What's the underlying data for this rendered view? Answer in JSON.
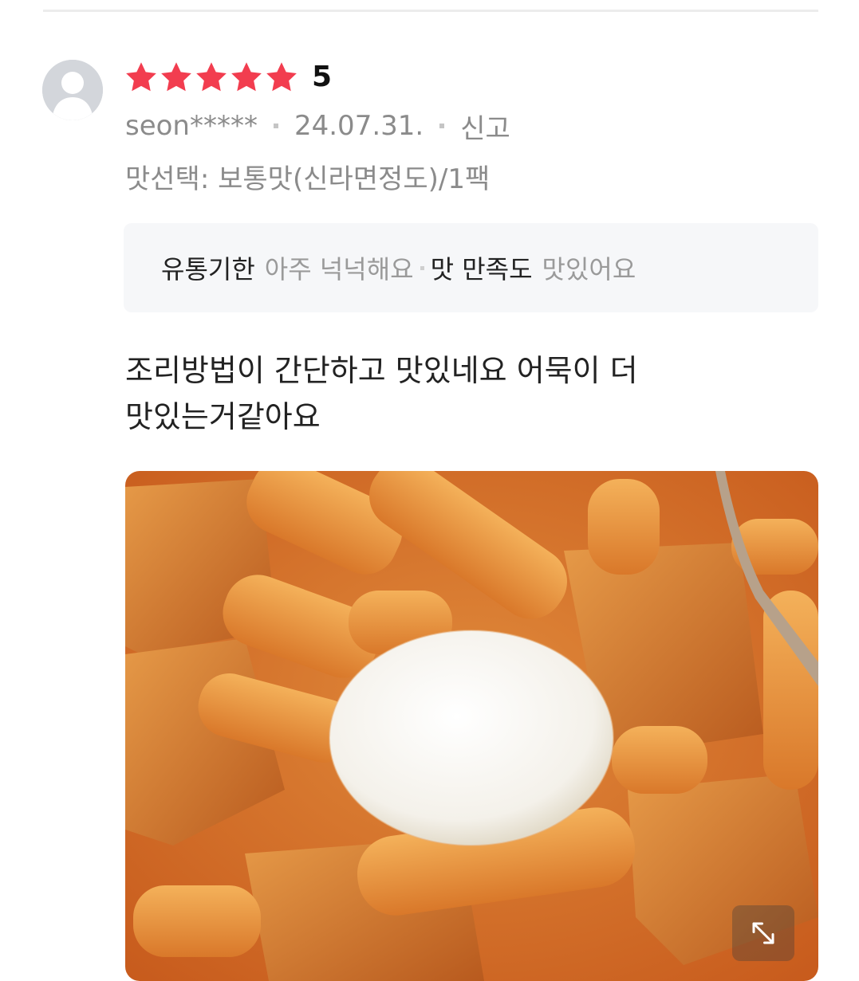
{
  "review": {
    "rating": "5",
    "stars_filled": 5,
    "stars_total": 5,
    "star_color": "#f23d4f",
    "user": "seon*****",
    "date": "24.07.31.",
    "report_label": "신고",
    "option": "맛선택: 보통맛(신라면정도)/1팩",
    "summary": [
      {
        "label": "유통기한",
        "value": "아주 넉넉해요"
      },
      {
        "label": "맛 만족도",
        "value": "맛있어요"
      }
    ],
    "text_lines": [
      "조리방법이 간단하고 맛있네요 어묵이 더",
      "맛있는거같아요"
    ],
    "photo_icon": "expand-icon"
  }
}
